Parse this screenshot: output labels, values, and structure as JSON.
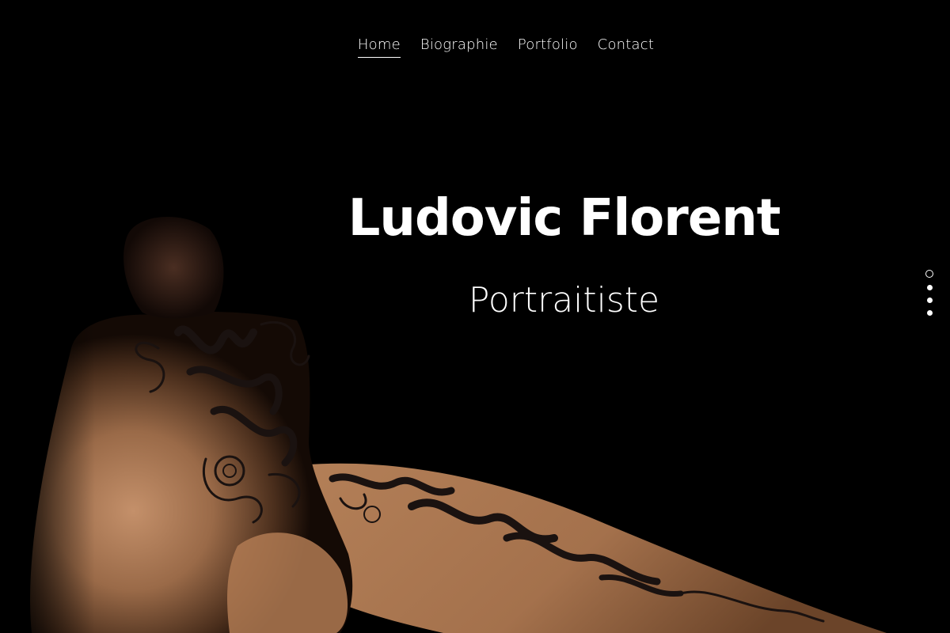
{
  "nav": {
    "items": [
      {
        "label": "Home",
        "active": true
      },
      {
        "label": "Biographie",
        "active": false
      },
      {
        "label": "Portfolio",
        "active": false
      },
      {
        "label": "Contact",
        "active": false
      }
    ]
  },
  "hero": {
    "title": "Ludovic Florent",
    "subtitle": "Portraitiste",
    "image_icon": "calligraphy-tattoo-portrait-photo"
  },
  "slider": {
    "count": 4,
    "active_index": 0
  },
  "colors": {
    "background": "#000000",
    "text": "#ffffff",
    "skin": "#b07a52"
  }
}
